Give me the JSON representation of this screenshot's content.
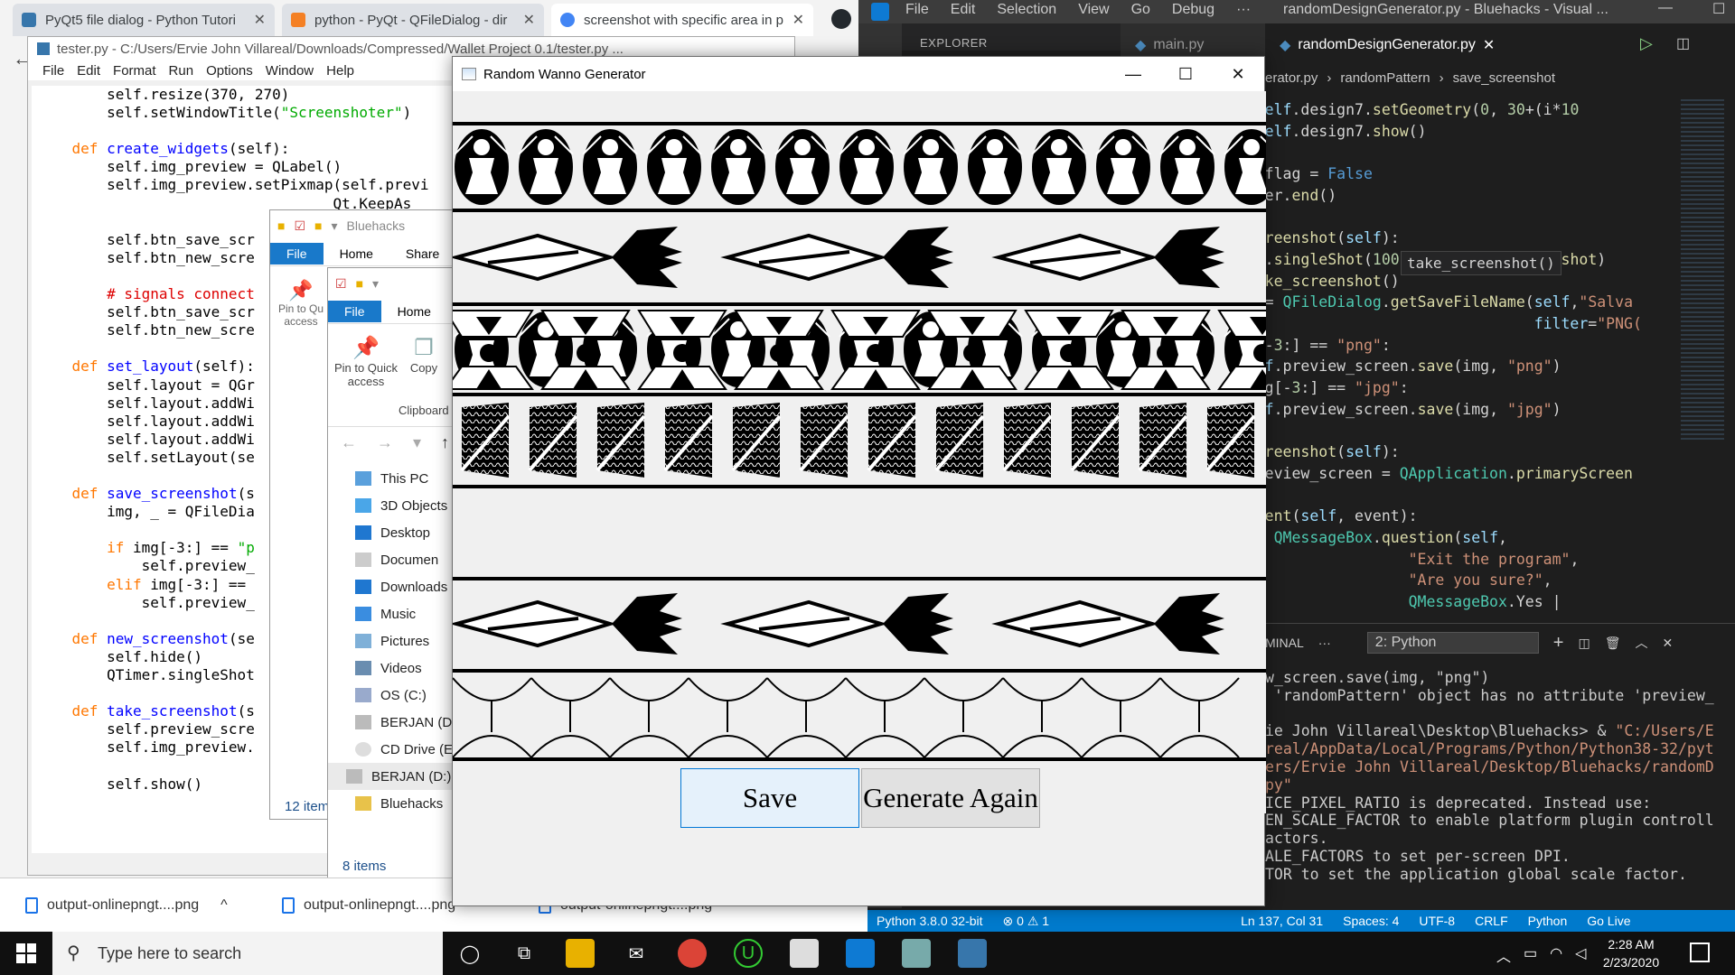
{
  "browser": {
    "tabs": [
      {
        "title": "PyQt5 file dialog - Python Tutori",
        "color": "#3776ab"
      },
      {
        "title": "python - PyQt - QFileDialog - dir",
        "color": "#f48024"
      },
      {
        "title": "screenshot with specific area in p",
        "color": "#4285f4"
      }
    ]
  },
  "vscode": {
    "menu": [
      "File",
      "Edit",
      "Selection",
      "View",
      "Go",
      "Debug",
      "···"
    ],
    "window_title": "randomDesignGenerator.py - Bluehacks - Visual ...",
    "explorer_label": "EXPLORER",
    "tabs": [
      "main.py",
      "randomDesignGenerator.py"
    ],
    "breadcrumbs": [
      "erator.py",
      "randomPattern",
      "save_screenshot"
    ],
    "tooltip": "take_screenshot()",
    "terminal_label": "MINAL",
    "terminal_select": "2: Python",
    "status": [
      "Python 3.8.0 32-bit",
      "⊗ 0 ⚠ 1",
      "Ln 137, Col 31",
      "Spaces: 4",
      "UTF-8",
      "CRLF",
      "Python",
      "Go Live"
    ]
  },
  "idle": {
    "title": "tester.py - C:/Users/Ervie John Villareal/Downloads/Compressed/Wallet Project 0.1/tester.py ...",
    "menu": [
      "File",
      "Edit",
      "Format",
      "Run",
      "Options",
      "Window",
      "Help"
    ]
  },
  "explorer1": {
    "qat_title": "Bluehacks",
    "tabs": [
      "File",
      "Home",
      "Share"
    ],
    "pin_label": "Pin to Qu access",
    "status": "12 item"
  },
  "explorer2": {
    "tabs": [
      "File",
      "Home"
    ],
    "pin_label": "Pin to Quick access",
    "copy_label": "Copy",
    "group_label": "Clipboard",
    "nav_items": [
      "This PC",
      "3D Objects",
      "Desktop",
      "Documen",
      "Downloads",
      "Music",
      "Pictures",
      "Videos",
      "OS (C:)",
      "BERJAN (D",
      "CD Drive (E",
      "BERJAN (D:)",
      "Bluehacks"
    ],
    "status": "8 items"
  },
  "downloads": [
    "output-onlinepngt....png",
    "output-onlinepngt....png",
    "output-onlinepngt....png"
  ],
  "app": {
    "title": "Random Wanno Generator",
    "save_label": "Save",
    "generate_label": "Generate Again"
  },
  "taskbar": {
    "search_placeholder": "Type here to search",
    "time": "2:28 AM",
    "date": "2/23/2020"
  }
}
